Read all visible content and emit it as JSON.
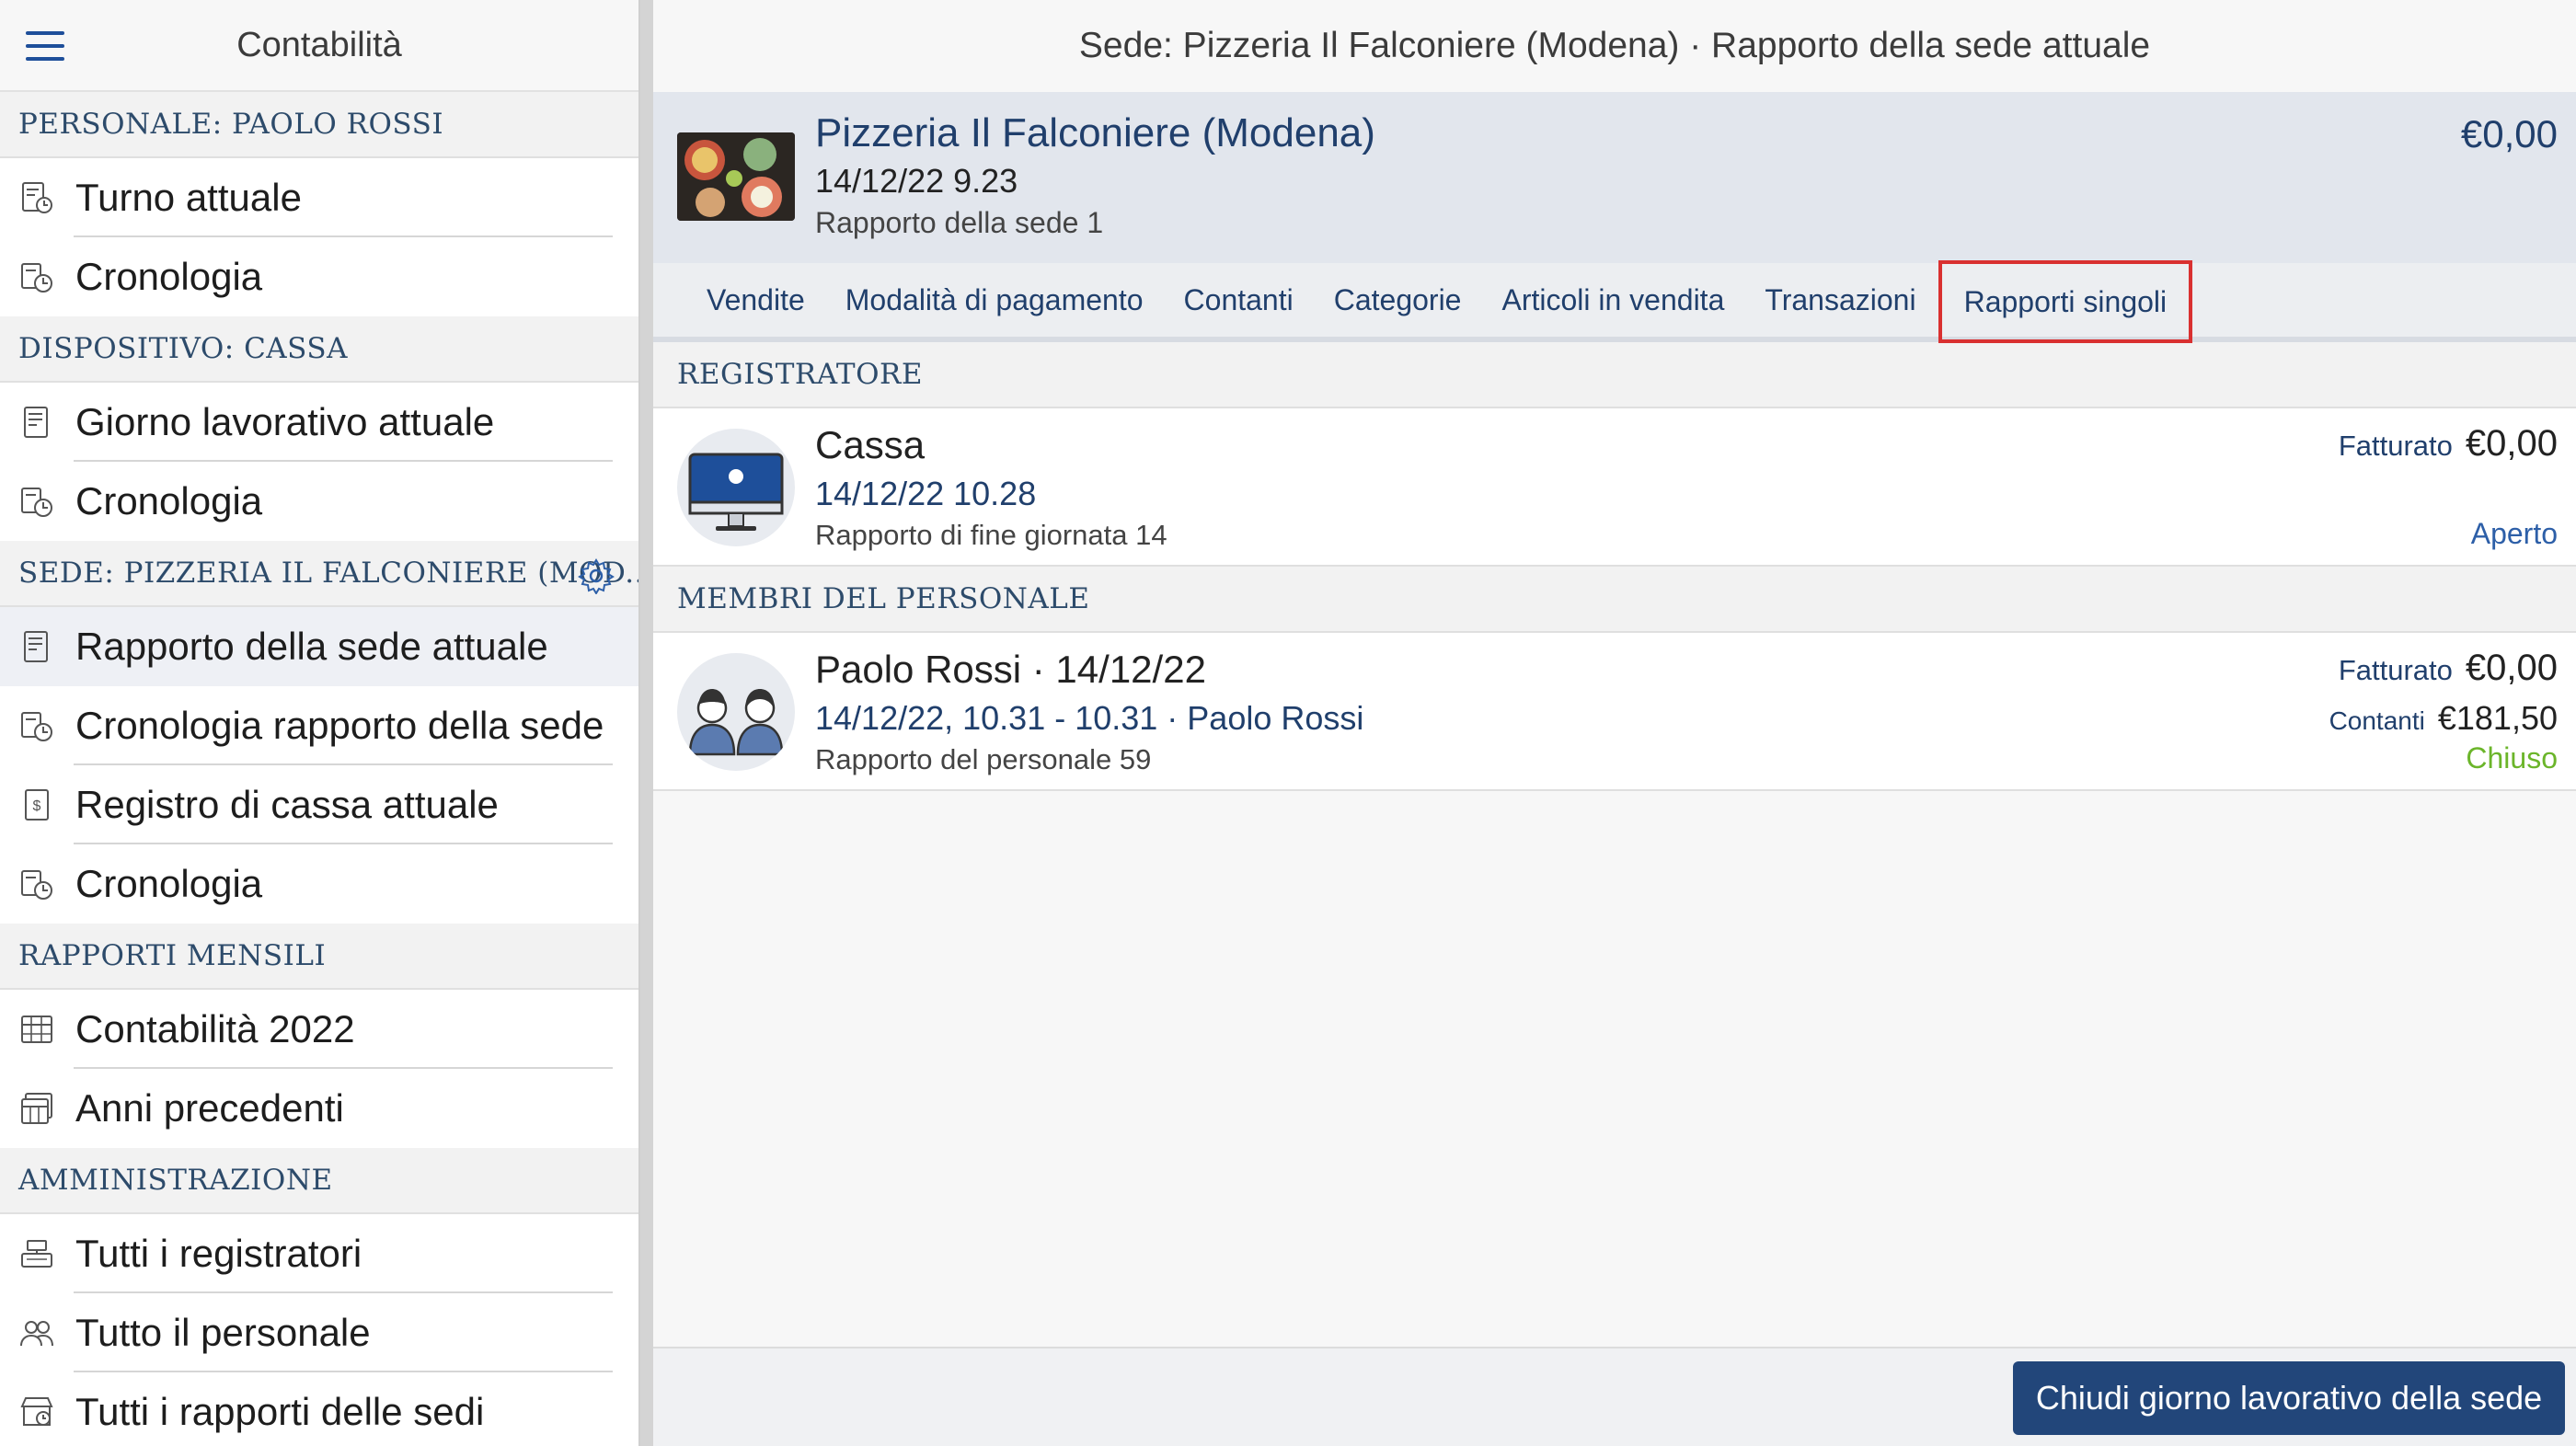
{
  "sidebar": {
    "title": "Contabilità",
    "sections": [
      {
        "title": "PERSONALE: PAOLO ROSSI",
        "items": [
          {
            "label": "Turno attuale",
            "icon": "receipt-clock-icon"
          },
          {
            "label": "Cronologia",
            "icon": "history-icon"
          }
        ]
      },
      {
        "title": "DISPOSITIVO: CASSA",
        "items": [
          {
            "label": "Giorno lavorativo attuale",
            "icon": "receipt-icon"
          },
          {
            "label": "Cronologia",
            "icon": "history-icon"
          }
        ]
      },
      {
        "title": "SEDE: PIZZERIA IL FALCONIERE (MOD...",
        "has_settings": true,
        "items": [
          {
            "label": "Rapporto della sede attuale",
            "icon": "receipt-icon",
            "active": true
          },
          {
            "label": "Cronologia rapporto della sede",
            "icon": "history-icon"
          },
          {
            "label": "Registro di cassa attuale",
            "icon": "cash-book-icon"
          },
          {
            "label": "Cronologia",
            "icon": "history-icon"
          }
        ]
      },
      {
        "title": "RAPPORTI MENSILI",
        "items": [
          {
            "label": "Contabilità 2022",
            "icon": "calendar-grid-icon"
          },
          {
            "label": "Anni precedenti",
            "icon": "calendar-stack-icon"
          }
        ]
      },
      {
        "title": "AMMINISTRAZIONE",
        "items": [
          {
            "label": "Tutti i registratori",
            "icon": "register-icon"
          },
          {
            "label": "Tutto il personale",
            "icon": "people-icon"
          },
          {
            "label": "Tutti i rapporti delle sedi",
            "icon": "store-report-icon"
          }
        ]
      }
    ]
  },
  "main": {
    "header_title": "Sede: Pizzeria Il Falconiere (Modena) · Rapporto della sede attuale",
    "venue": {
      "name": "Pizzeria Il Falconiere (Modena)",
      "date": "14/12/22 9.23",
      "subtitle": "Rapporto della sede 1",
      "amount": "€0,00"
    },
    "tabs": [
      {
        "label": "Vendite"
      },
      {
        "label": "Modalità di pagamento"
      },
      {
        "label": "Contanti"
      },
      {
        "label": "Categorie"
      },
      {
        "label": "Articoli in vendita"
      },
      {
        "label": "Transazioni"
      },
      {
        "label": "Rapporti singoli",
        "selected": true
      }
    ],
    "sections": {
      "registers": {
        "title": "REGISTRATORE",
        "row": {
          "title": "Cassa",
          "date": "14/12/22 10.28",
          "subtitle": "Rapporto di fine giornata 14",
          "revenue_label": "Fatturato",
          "revenue_value": "€0,00",
          "status": "Aperto",
          "status_color": "#2d5fa8"
        }
      },
      "staff": {
        "title": "MEMBRI DEL PERSONALE",
        "row": {
          "title": "Paolo Rossi · 14/12/22",
          "date": "14/12/22, 10.31 - 10.31 · Paolo Rossi",
          "subtitle": "Rapporto del personale 59",
          "revenue_label": "Fatturato",
          "revenue_value": "€0,00",
          "cash_label": "Contanti",
          "cash_value": "€181,50",
          "status": "Chiuso",
          "status_color": "#6bb52a"
        }
      }
    },
    "footer": {
      "close_button": "Chiudi giorno lavorativo della sede"
    }
  },
  "colors": {
    "accent": "#22467a",
    "selection_outline": "#d93030"
  }
}
